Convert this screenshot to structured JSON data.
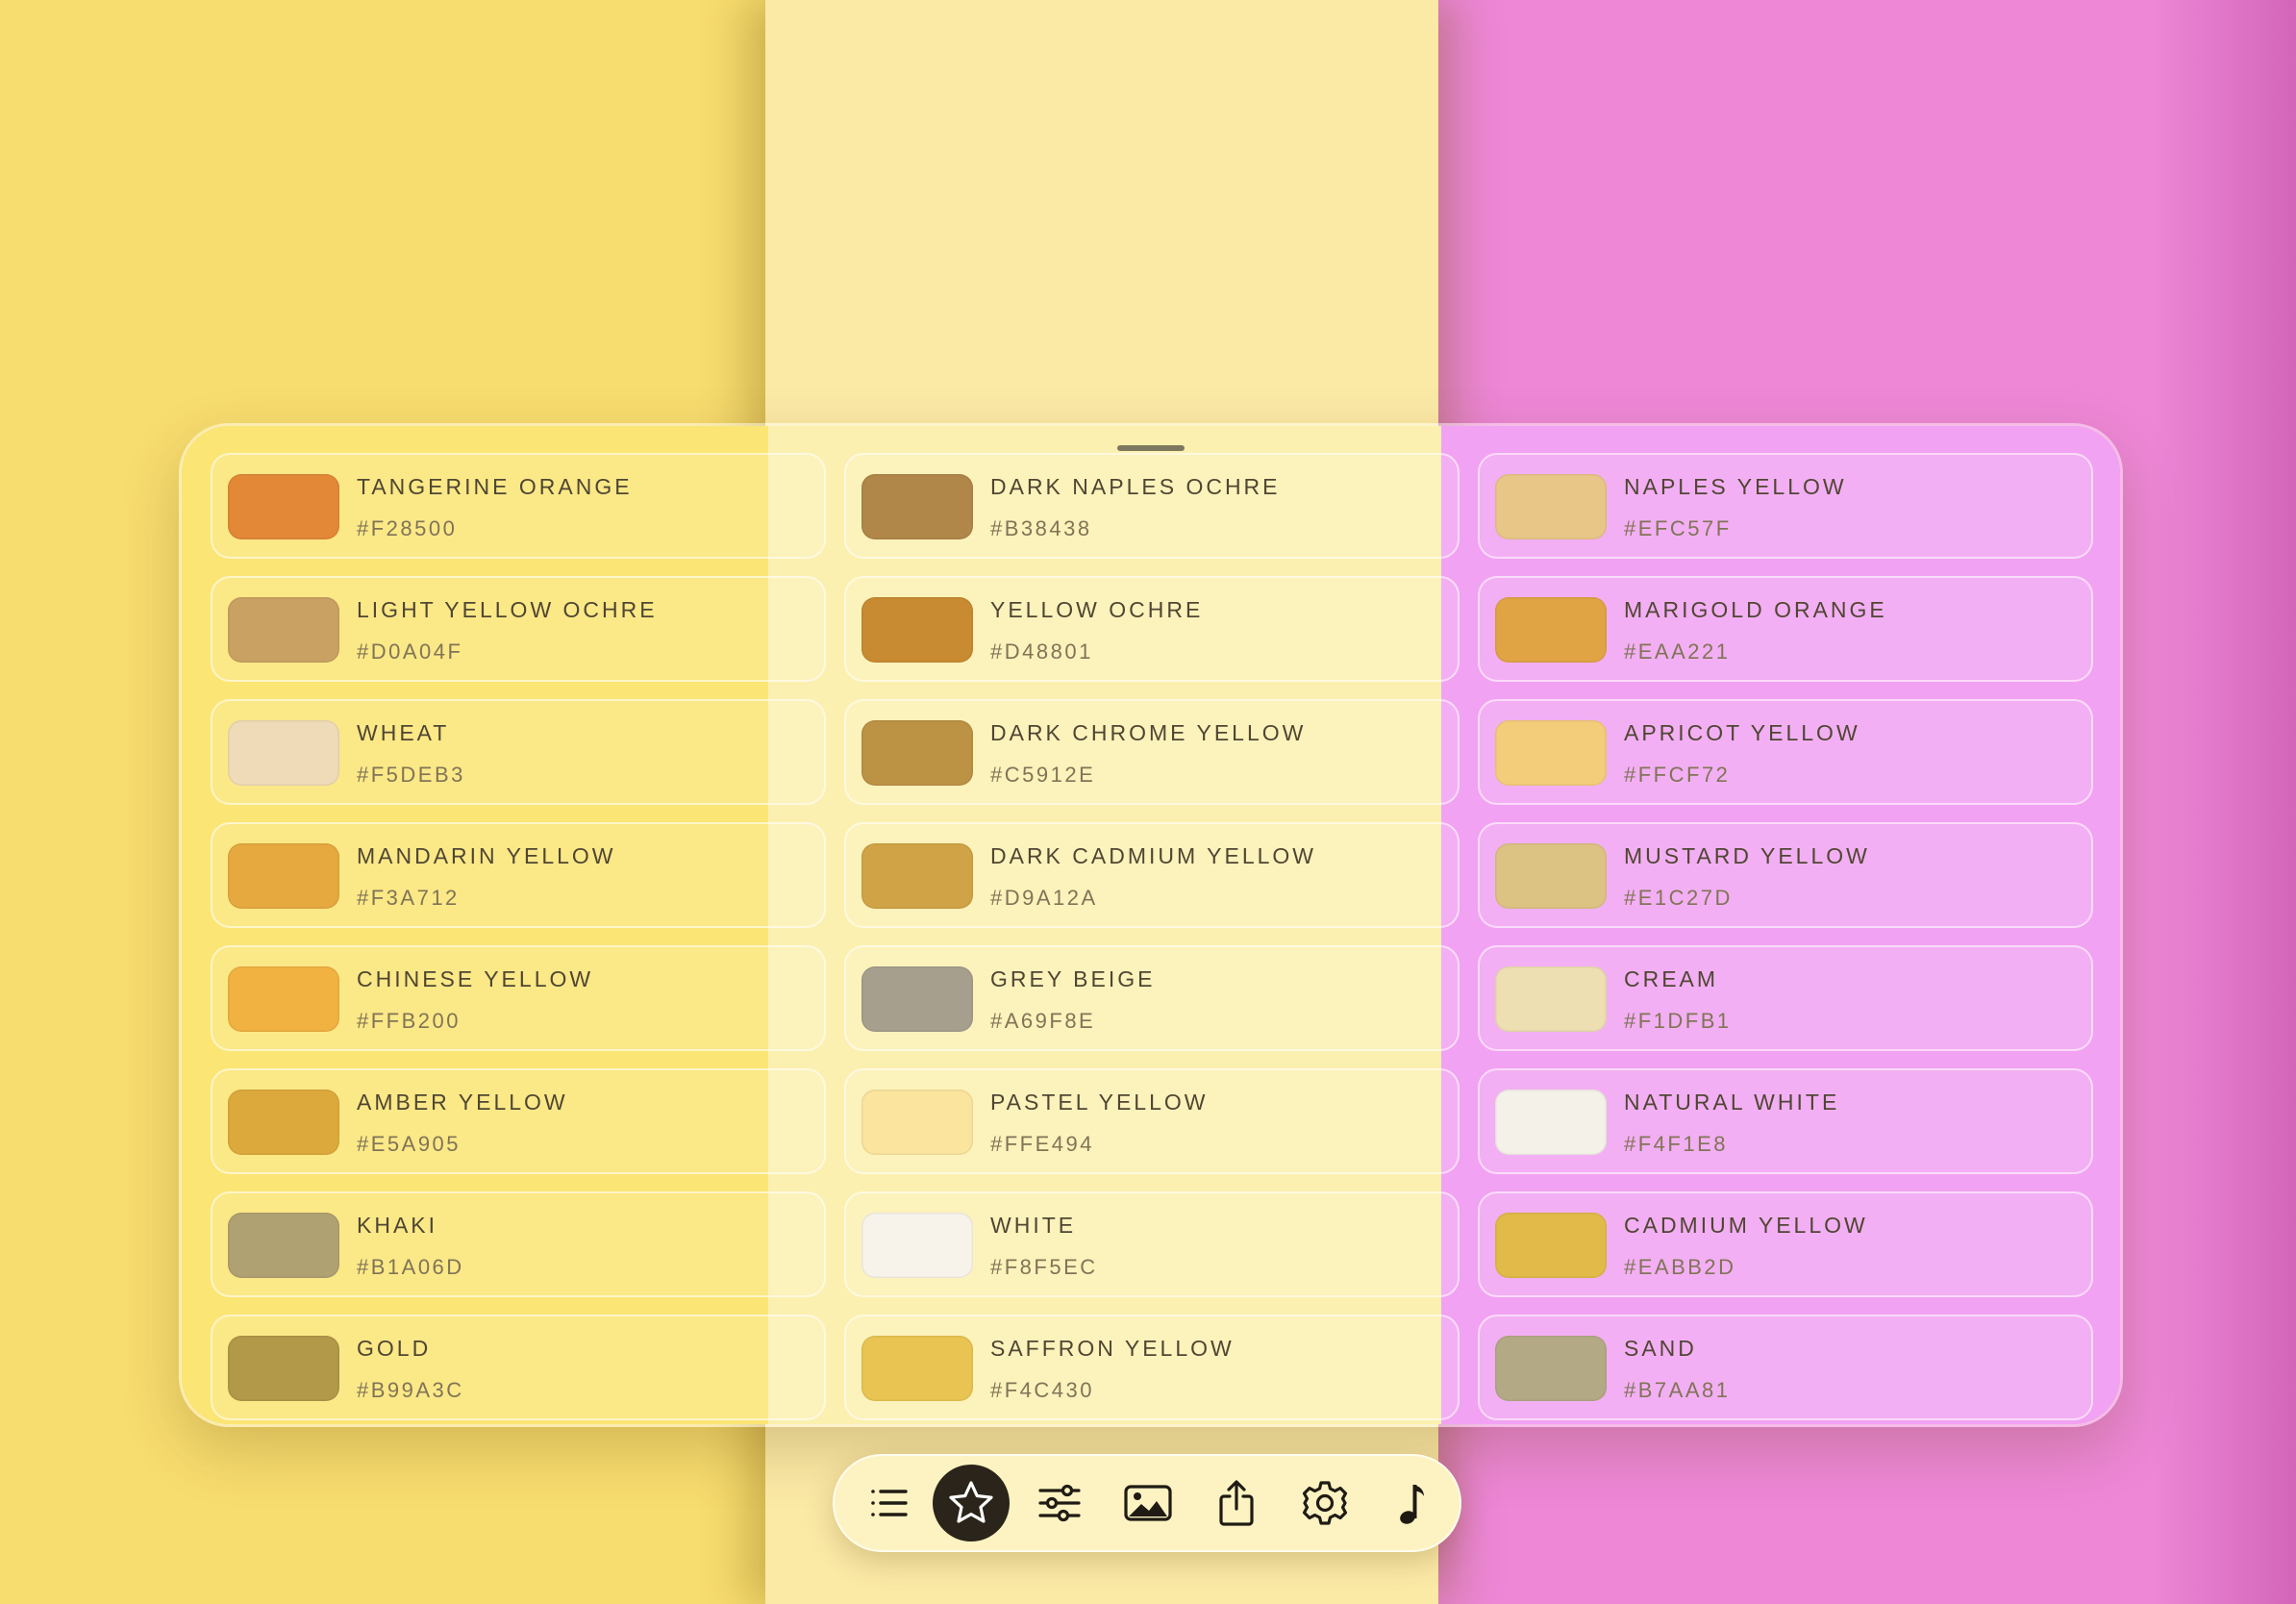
{
  "background": {
    "colors": [
      "#f7dc6f",
      "#fbe9a6",
      "#ed87d6"
    ]
  },
  "palette": {
    "columns": [
      [
        {
          "name": "TANGERINE ORANGE",
          "hex": "#F28500",
          "swatch": "#e38837"
        },
        {
          "name": "LIGHT YELLOW OCHRE",
          "hex": "#D0A04F",
          "swatch": "#c9a263"
        },
        {
          "name": "WHEAT",
          "hex": "#F5DEB3",
          "swatch": "#efdbb7"
        },
        {
          "name": "MANDARIN YELLOW",
          "hex": "#F3A712",
          "swatch": "#e6a940"
        },
        {
          "name": "CHINESE YELLOW",
          "hex": "#FFB200",
          "swatch": "#f1b241"
        },
        {
          "name": "AMBER YELLOW",
          "hex": "#E5A905",
          "swatch": "#dcaa3c"
        },
        {
          "name": "KHAKI",
          "hex": "#B1A06D",
          "swatch": "#b0a172"
        },
        {
          "name": "GOLD",
          "hex": "#B99A3C",
          "swatch": "#b19949"
        }
      ],
      [
        {
          "name": "DARK NAPLES OCHRE",
          "hex": "#B38438",
          "swatch": "#b08748"
        },
        {
          "name": "YELLOW OCHRE",
          "hex": "#D48801",
          "swatch": "#c98b32"
        },
        {
          "name": "DARK CHROME YELLOW",
          "hex": "#C5912E",
          "swatch": "#bc9245"
        },
        {
          "name": "DARK CADMIUM YELLOW",
          "hex": "#D9A12A",
          "swatch": "#d0a446"
        },
        {
          "name": "GREY BEIGE",
          "hex": "#A69F8E",
          "swatch": "#a69f8e"
        },
        {
          "name": "PASTEL YELLOW",
          "hex": "#FFE494",
          "swatch": "#fbe49e"
        },
        {
          "name": "WHITE",
          "hex": "#F8F5EC",
          "swatch": "#f7f3ea"
        },
        {
          "name": "SAFFRON YELLOW",
          "hex": "#F4C430",
          "swatch": "#e9c452"
        }
      ],
      [
        {
          "name": "NAPLES YELLOW",
          "hex": "#EFC57F",
          "swatch": "#e8c687"
        },
        {
          "name": "MARIGOLD ORANGE",
          "hex": "#EAA221",
          "swatch": "#e1a445"
        },
        {
          "name": "APRICOT YELLOW",
          "hex": "#FFCF72",
          "swatch": "#f4cd7a"
        },
        {
          "name": "MUSTARD YELLOW",
          "hex": "#E1C27D",
          "swatch": "#dcc383"
        },
        {
          "name": "CREAM",
          "hex": "#F1DFB1",
          "swatch": "#eedfb2"
        },
        {
          "name": "NATURAL WHITE",
          "hex": "#F4F1E8",
          "swatch": "#f4f1e8"
        },
        {
          "name": "CADMIUM YELLOW",
          "hex": "#EABB2D",
          "swatch": "#e2ba49"
        },
        {
          "name": "SAND",
          "hex": "#B7AA81",
          "swatch": "#b3aa85"
        }
      ]
    ]
  },
  "tabbar": {
    "items": [
      {
        "icon": "list-icon",
        "active": false
      },
      {
        "icon": "star-icon",
        "active": true
      },
      {
        "icon": "sliders-icon",
        "active": false
      },
      {
        "icon": "image-icon",
        "active": false
      },
      {
        "icon": "share-icon",
        "active": false
      },
      {
        "icon": "gear-icon",
        "active": false
      },
      {
        "icon": "music-note-icon",
        "active": false
      }
    ]
  }
}
